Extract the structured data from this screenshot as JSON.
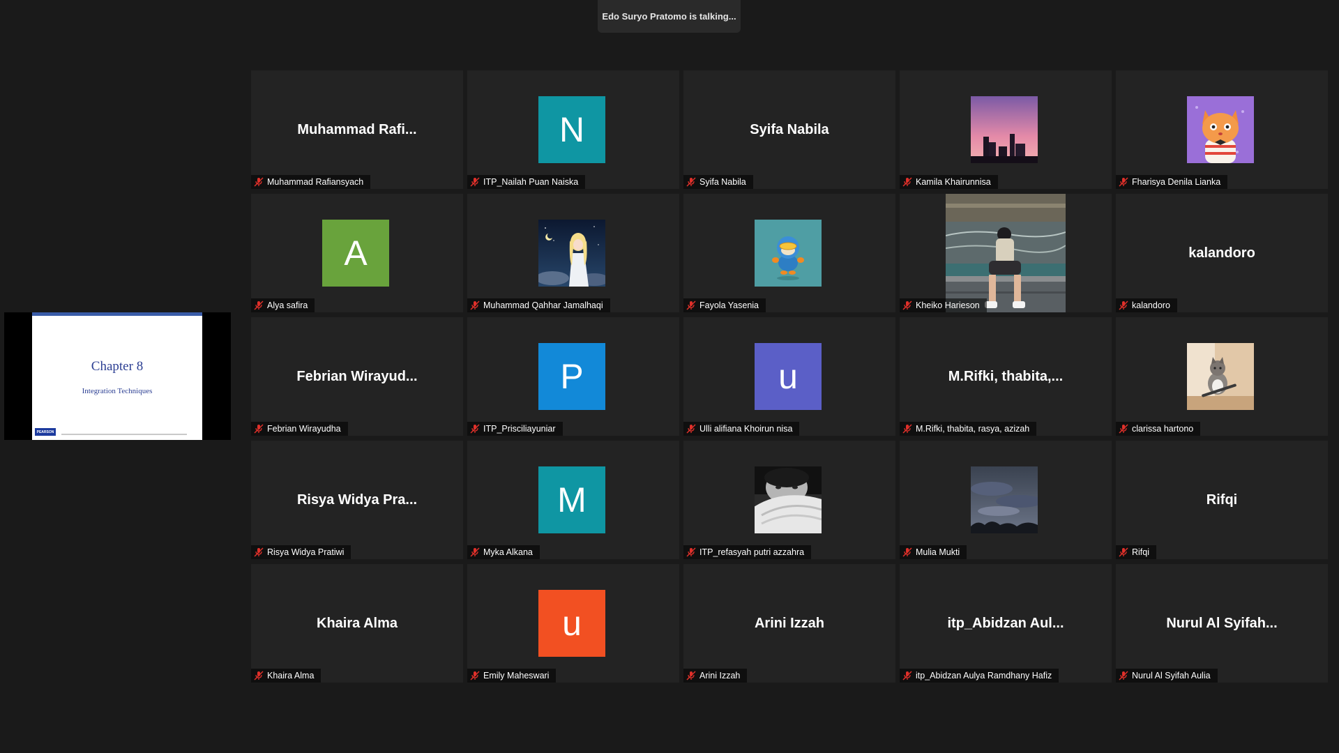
{
  "talking_indicator": "Edo Suryo Pratomo is talking...",
  "shared_screen": {
    "slide_title": "Chapter 8",
    "slide_subtitle": "Integration Techniques",
    "publisher_logo": "PEARSON"
  },
  "colors": {
    "background": "#1a1a1a",
    "tile": "#232323",
    "muted_icon": "#e0302a",
    "avatar_teal": "#0f96a3",
    "avatar_green": "#69a33c",
    "avatar_blue": "#1289d8",
    "avatar_purple": "#5b5fc7",
    "avatar_orange": "#f25022"
  },
  "participants": [
    {
      "label": "Muhammad Rafiansyach",
      "display": "Muhammad  Rafi...",
      "kind": "name",
      "muted": true
    },
    {
      "label": "ITP_Nailah Puan Naiska",
      "letter": "N",
      "kind": "letter",
      "color": "#0f96a3",
      "muted": true
    },
    {
      "label": "Syifa Nabila",
      "display": "Syifa Nabila",
      "kind": "name",
      "muted": true
    },
    {
      "label": "Kamila Khairunnisa",
      "kind": "photo",
      "photo": "city-sunset",
      "muted": true
    },
    {
      "label": "Fharisya Denila Lianka",
      "kind": "photo",
      "photo": "cartoon-cat",
      "muted": true
    },
    {
      "label": "Alya safira",
      "letter": "A",
      "kind": "letter",
      "color": "#69a33c",
      "muted": true
    },
    {
      "label": "Muhammad Qahhar Jamalhaqi",
      "kind": "photo",
      "photo": "anime-night",
      "muted": true
    },
    {
      "label": "Fayola Yasenia",
      "kind": "photo",
      "photo": "cartoon-character",
      "muted": true
    },
    {
      "label": "Kheiko Harieson",
      "kind": "video",
      "photo": "person-fountain",
      "muted": true
    },
    {
      "label": "kalandoro",
      "display": "kalandoro",
      "kind": "name",
      "muted": true
    },
    {
      "label": "Febrian Wirayudha",
      "display": "Febrian  Wirayud...",
      "kind": "name",
      "muted": true
    },
    {
      "label": "ITP_Prisciliayuniar",
      "letter": "P",
      "kind": "letter",
      "color": "#1289d8",
      "muted": true
    },
    {
      "label": "Ulli alifiana Khoirun nisa",
      "letter": "u",
      "kind": "letter",
      "color": "#5b5fc7",
      "muted": true
    },
    {
      "label": "M.Rifki, thabita, rasya, azizah",
      "display": "M.Rifki,  thabita,...",
      "kind": "name",
      "muted": true
    },
    {
      "label": "clarissa hartono",
      "kind": "photo",
      "photo": "cat-photo",
      "muted": true
    },
    {
      "label": "Risya Widya Pratiwi",
      "display": "Risya  Widya  Pra...",
      "kind": "name",
      "muted": true
    },
    {
      "label": "Myka Alkana",
      "letter": "M",
      "kind": "letter",
      "color": "#0f96a3",
      "muted": true
    },
    {
      "label": "ITP_refasyah putri azzahra",
      "kind": "photo",
      "photo": "bw-portrait",
      "muted": true
    },
    {
      "label": "Mulia Mukti",
      "kind": "photo",
      "photo": "cloudy-sky",
      "muted": true
    },
    {
      "label": "Rifqi",
      "display": "Rifqi",
      "kind": "name",
      "muted": true
    },
    {
      "label": "Khaira Alma",
      "display": "Khaira Alma",
      "kind": "name",
      "muted": true
    },
    {
      "label": "Emily Maheswari",
      "letter": "u",
      "kind": "letter",
      "color": "#f25022",
      "muted": true
    },
    {
      "label": "Arini Izzah",
      "display": "Arini Izzah",
      "kind": "name",
      "muted": true
    },
    {
      "label": "itp_Abidzan Aulya Ramdhany Hafiz",
      "display": "itp_Abidzan  Aul...",
      "kind": "name",
      "muted": true
    },
    {
      "label": "Nurul Al Syifah Aulia",
      "display": "Nurul  Al  Syifah...",
      "kind": "name",
      "muted": true
    }
  ]
}
